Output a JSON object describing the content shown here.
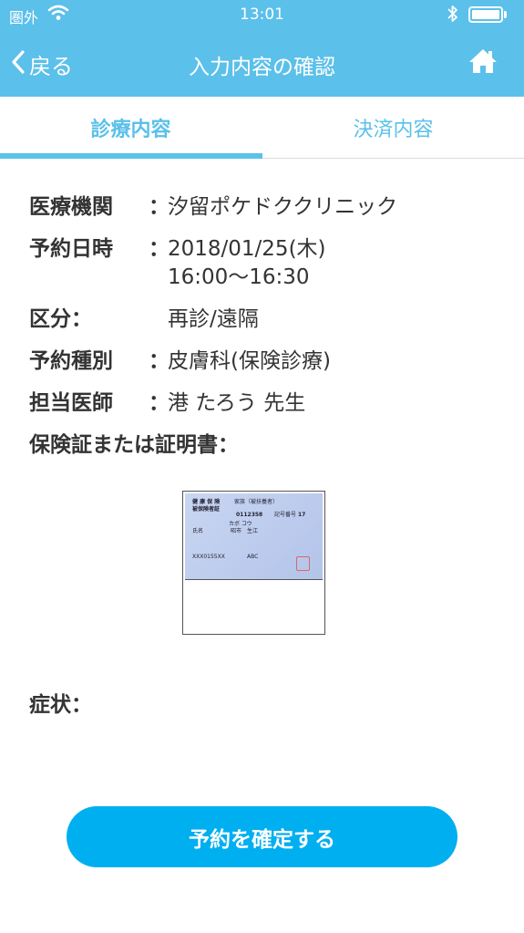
{
  "statusbar": {
    "carrier": "圏外",
    "time": "13:01"
  },
  "nav": {
    "back_label": "戻る",
    "title": "入力内容の確認",
    "home_icon": "home-icon"
  },
  "tabs": [
    {
      "label": "診療内容",
      "selected": true
    },
    {
      "label": "決済内容",
      "selected": false
    }
  ],
  "details": {
    "facility_label": "医療機関",
    "facility_value": "汐留ポケドククリニック",
    "datetime_label": "予約日時",
    "datetime_date": "2018/01/25(木)",
    "datetime_time": "16:00〜16:30",
    "category_label": "区分：",
    "category_value": "再診/遠隔",
    "type_label": "予約種別",
    "type_value": "皮膚科(保険診療)",
    "doctor_label": "担当医師",
    "doctor_value": "港 たろう 先生",
    "insurance_label": "保険証または証明書：",
    "colon": "："
  },
  "card": {
    "title_line1": "健 康 保 険",
    "title_line2": "被保険者証",
    "kind": "家族（被扶養者）",
    "number_prefix": "記号",
    "number": "0112358",
    "branch_label": "番号",
    "branch": "17",
    "furigana": "カボ コウ",
    "name_label": "氏名",
    "name": "昭市　生江",
    "code": "XXX0155XX",
    "code2": "ABC"
  },
  "symptom_label": "症状：",
  "confirm_button": "予約を確定する",
  "colors": {
    "header": "#5bc0ea",
    "accent": "#00aff0",
    "text": "#333333"
  }
}
